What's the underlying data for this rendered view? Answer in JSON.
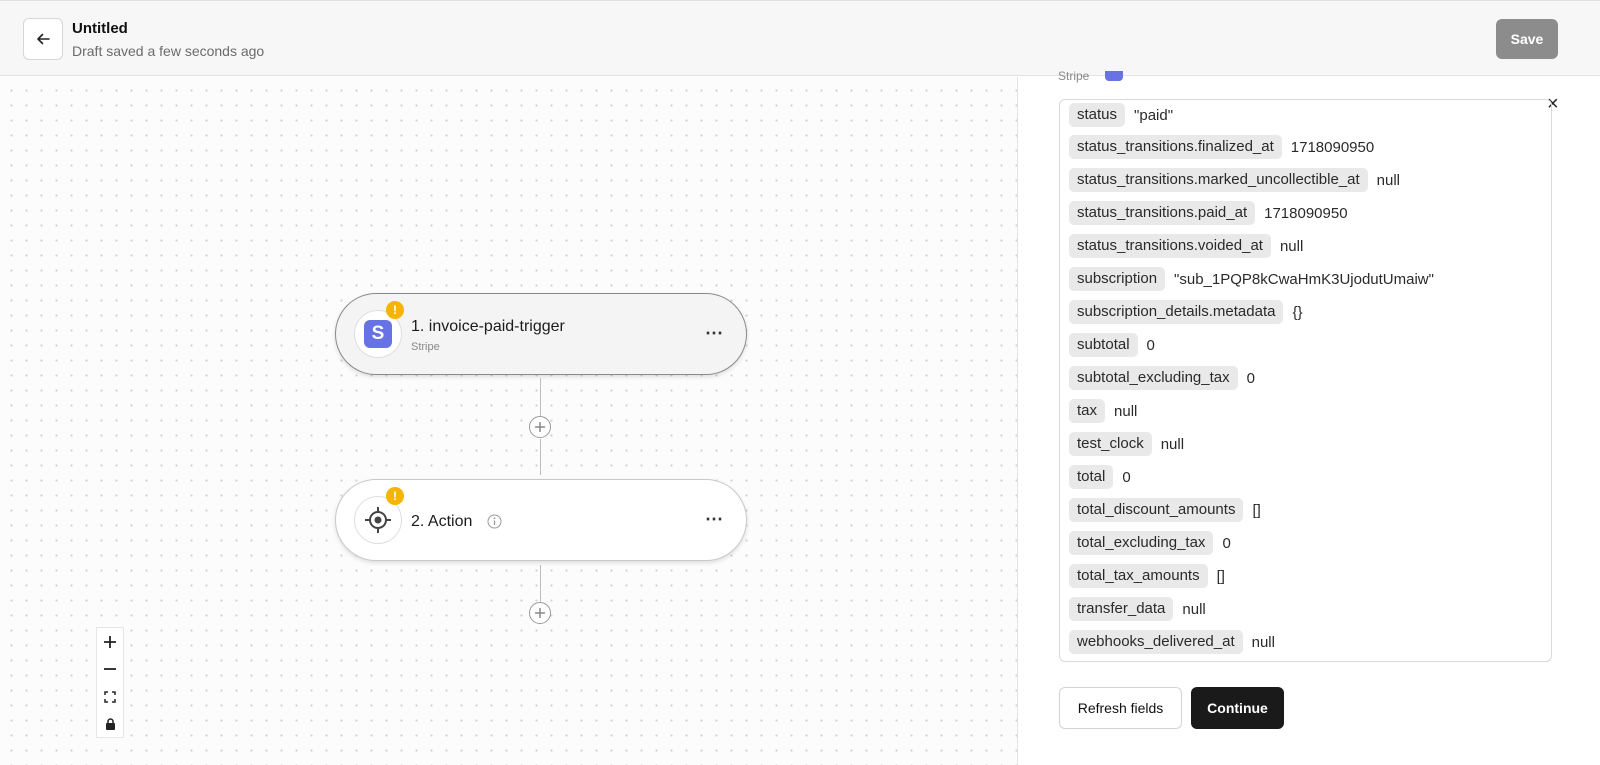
{
  "header": {
    "title": "Untitled",
    "subtitle": "Draft saved a few seconds ago",
    "save_label": "Save"
  },
  "canvas": {
    "nodes": [
      {
        "title": "1. invoice-paid-trigger",
        "subtitle": "Stripe",
        "icon": "stripe-logo-icon",
        "badge": "!",
        "menu": "⋯"
      },
      {
        "title": "2. Action",
        "icon": "target-icon",
        "badge": "!",
        "menu": "⋯"
      }
    ],
    "zoom_controls": [
      "zoom-in",
      "zoom-out",
      "fit-view",
      "lock"
    ]
  },
  "panel": {
    "app_name": "Stripe",
    "fields": [
      {
        "key": "status",
        "value": "\"paid\""
      },
      {
        "key": "status_transitions.finalized_at",
        "value": "1718090950"
      },
      {
        "key": "status_transitions.marked_uncollectible_at",
        "value": "null"
      },
      {
        "key": "status_transitions.paid_at",
        "value": "1718090950"
      },
      {
        "key": "status_transitions.voided_at",
        "value": "null"
      },
      {
        "key": "subscription",
        "value": "\"sub_1PQP8kCwaHmK3UjodutUmaiw\""
      },
      {
        "key": "subscription_details.metadata",
        "value": "{}"
      },
      {
        "key": "subtotal",
        "value": "0"
      },
      {
        "key": "subtotal_excluding_tax",
        "value": "0"
      },
      {
        "key": "tax",
        "value": "null"
      },
      {
        "key": "test_clock",
        "value": "null"
      },
      {
        "key": "total",
        "value": "0"
      },
      {
        "key": "total_discount_amounts",
        "value": "[]"
      },
      {
        "key": "total_excluding_tax",
        "value": "0"
      },
      {
        "key": "total_tax_amounts",
        "value": "[]"
      },
      {
        "key": "transfer_data",
        "value": "null"
      },
      {
        "key": "webhooks_delivered_at",
        "value": "null"
      }
    ],
    "refresh_label": "Refresh fields",
    "continue_label": "Continue",
    "close_label": "×"
  },
  "colors": {
    "save_disabled": "#8c8c8c",
    "stripe": "#6772e5",
    "warning": "#f4b400",
    "primary_dark": "#1a1a1a"
  }
}
